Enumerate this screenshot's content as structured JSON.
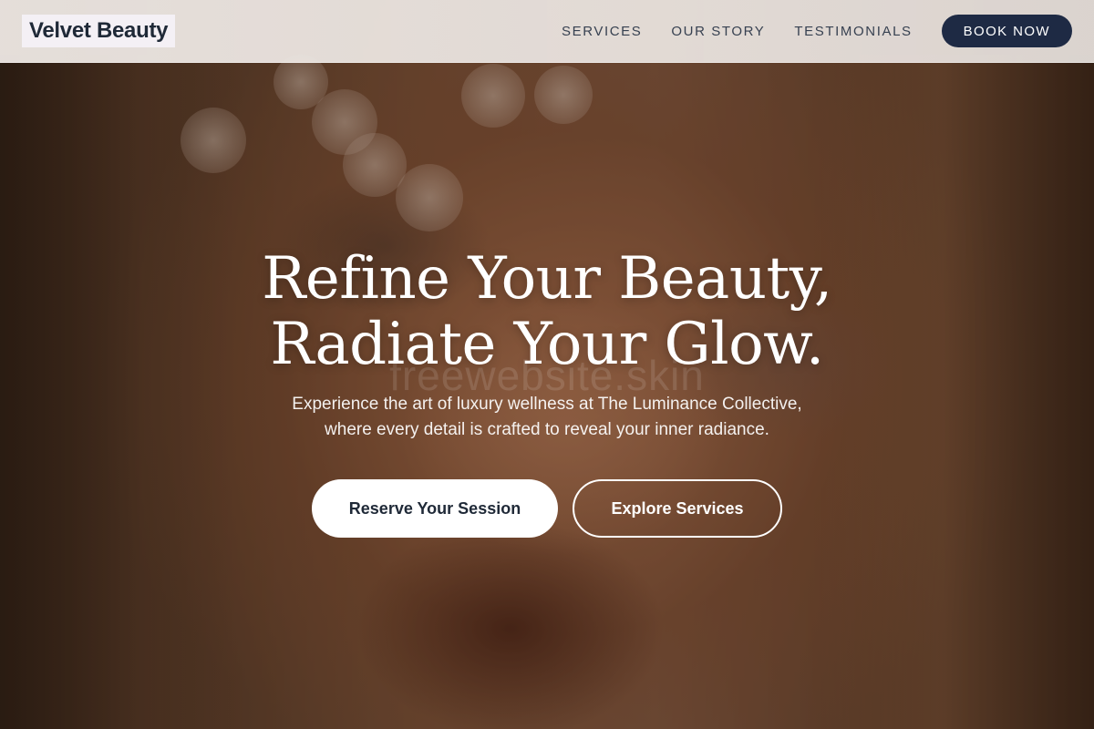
{
  "brand": {
    "name": "Velvet Beauty"
  },
  "nav": {
    "links": [
      "SERVICES",
      "OUR STORY",
      "TESTIMONIALS"
    ],
    "cta_label": "BOOK NOW"
  },
  "hero": {
    "headline_line1": "Refine Your Beauty,",
    "headline_line2": "Radiate Your Glow.",
    "subtext_line1": "Experience the art of luxury wellness at The Luminance Collective,",
    "subtext_line2": "where every detail is crafted to reveal your inner radiance.",
    "primary_cta": "Reserve Your Session",
    "secondary_cta": "Explore Services",
    "watermark": "freewebsite.skin"
  },
  "colors": {
    "accent_dark": "#1e2a44",
    "header_bg": "#eee8e4",
    "text_light": "#ffffff"
  }
}
